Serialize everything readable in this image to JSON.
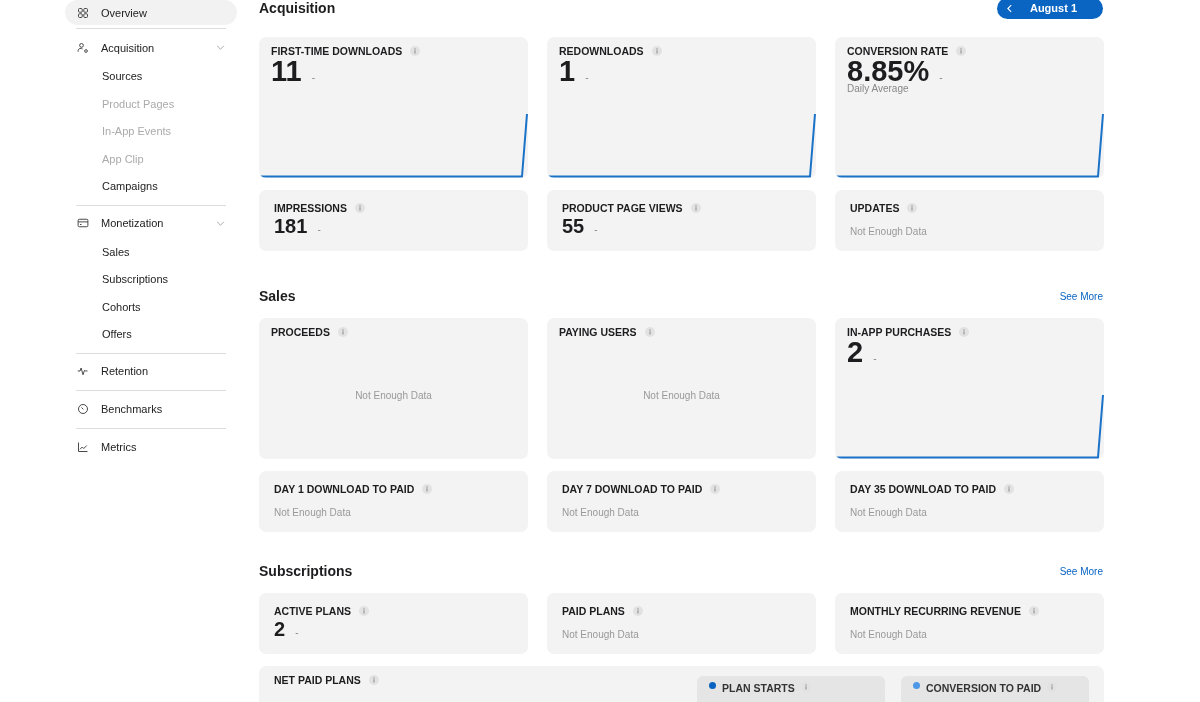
{
  "sidebar": {
    "items": [
      {
        "label": "Overview",
        "selected": true
      },
      {
        "label": "Acquisition",
        "selected": false,
        "expanded": true,
        "children": [
          {
            "label": "Sources",
            "disabled": false
          },
          {
            "label": "Product Pages",
            "disabled": true
          },
          {
            "label": "In-App Events",
            "disabled": true
          },
          {
            "label": "App Clip",
            "disabled": true
          },
          {
            "label": "Campaigns",
            "disabled": false
          }
        ]
      },
      {
        "label": "Monetization",
        "selected": false,
        "expanded": true,
        "children": [
          {
            "label": "Sales",
            "disabled": false
          },
          {
            "label": "Subscriptions",
            "disabled": false
          },
          {
            "label": "Cohorts",
            "disabled": false
          },
          {
            "label": "Offers",
            "disabled": false
          }
        ]
      },
      {
        "label": "Retention",
        "selected": false
      },
      {
        "label": "Benchmarks",
        "selected": false
      },
      {
        "label": "Metrics",
        "selected": false
      }
    ]
  },
  "date_button": {
    "label": "August 1"
  },
  "sections": [
    {
      "title": "Acquisition",
      "cards": [
        {
          "kind": "trend",
          "label": "FIRST-TIME DOWNLOADS",
          "value": "11",
          "delta": "-"
        },
        {
          "kind": "trend",
          "label": "REDOWNLOADS",
          "value": "1",
          "delta": "-"
        },
        {
          "kind": "trend",
          "label": "CONVERSION RATE",
          "value": "8.85%",
          "delta": "-",
          "subtitle": "Daily Average"
        },
        {
          "kind": "stat",
          "label": "IMPRESSIONS",
          "value": "181",
          "delta": "-"
        },
        {
          "kind": "stat",
          "label": "PRODUCT PAGE VIEWS",
          "value": "55",
          "delta": "-"
        },
        {
          "kind": "empty",
          "label": "UPDATES",
          "message": "Not Enough Data"
        }
      ]
    },
    {
      "title": "Sales",
      "link": "See More",
      "cards": [
        {
          "kind": "empty_chart",
          "label": "PROCEEDS",
          "message": "Not Enough Data"
        },
        {
          "kind": "empty_chart",
          "label": "PAYING USERS",
          "message": "Not Enough Data"
        },
        {
          "kind": "trend",
          "label": "IN-APP PURCHASES",
          "value": "2",
          "delta": "-"
        },
        {
          "kind": "empty",
          "label": "DAY 1 DOWNLOAD TO PAID",
          "message": "Not Enough Data"
        },
        {
          "kind": "empty",
          "label": "DAY 7 DOWNLOAD TO PAID",
          "message": "Not Enough Data"
        },
        {
          "kind": "empty",
          "label": "DAY 35 DOWNLOAD TO PAID",
          "message": "Not Enough Data"
        }
      ]
    },
    {
      "title": "Subscriptions",
      "link": "See More",
      "cards": [
        {
          "kind": "stat",
          "label": "ACTIVE PLANS",
          "value": "2",
          "delta": "-"
        },
        {
          "kind": "empty",
          "label": "PAID PLANS",
          "message": "Not Enough Data"
        },
        {
          "kind": "empty",
          "label": "MONTHLY RECURRING REVENUE",
          "message": "Not Enough Data"
        },
        {
          "kind": "wide",
          "label": "NET PAID PLANS",
          "legend": [
            {
              "label": "PLAN STARTS",
              "color": "#0a63c2"
            },
            {
              "label": "CONVERSION TO PAID",
              "color": "#4d97e6"
            }
          ]
        }
      ]
    }
  ]
}
